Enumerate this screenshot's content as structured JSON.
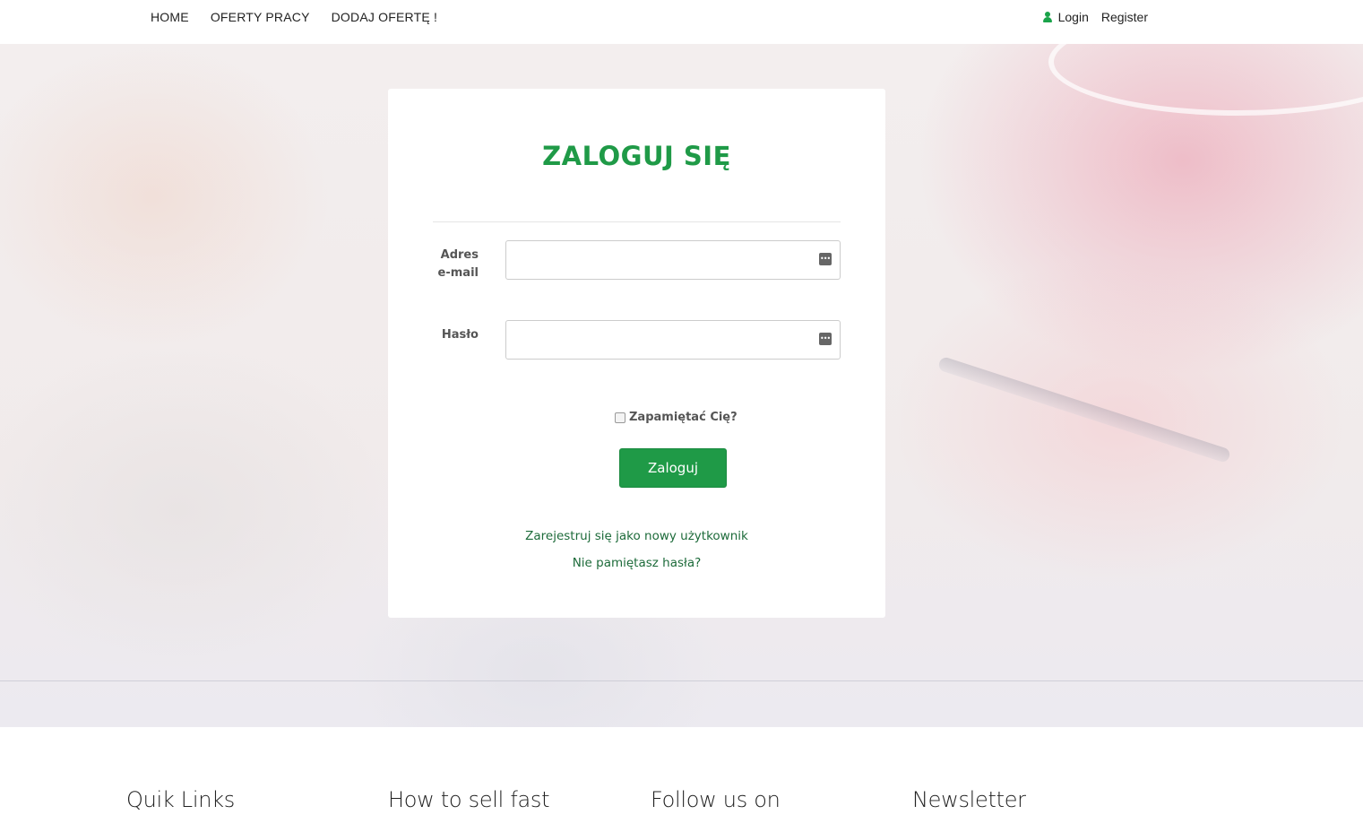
{
  "nav": {
    "left_items": [
      "HOME",
      "OFERTY PRACY",
      "DODAJ OFERTĘ !"
    ],
    "login_label": "Login",
    "register_label": "Register"
  },
  "login": {
    "title": "ZALOGUJ SIĘ",
    "email_label": "Adres e-mail",
    "email_value": "",
    "password_label": "Hasło",
    "password_value": "",
    "remember_label": "Zapamiętać Cię?",
    "remember_checked": false,
    "submit_label": "Zaloguj",
    "register_link": "Zarejestruj się jako nowy użytkownik",
    "forgot_link": "Nie pamiętasz hasła?"
  },
  "footer": {
    "columns": [
      "Quik Links",
      "How to sell fast",
      "Follow us on",
      "Newsletter"
    ]
  },
  "colors": {
    "accent": "#1f9a47",
    "link": "#1d6b3a"
  }
}
